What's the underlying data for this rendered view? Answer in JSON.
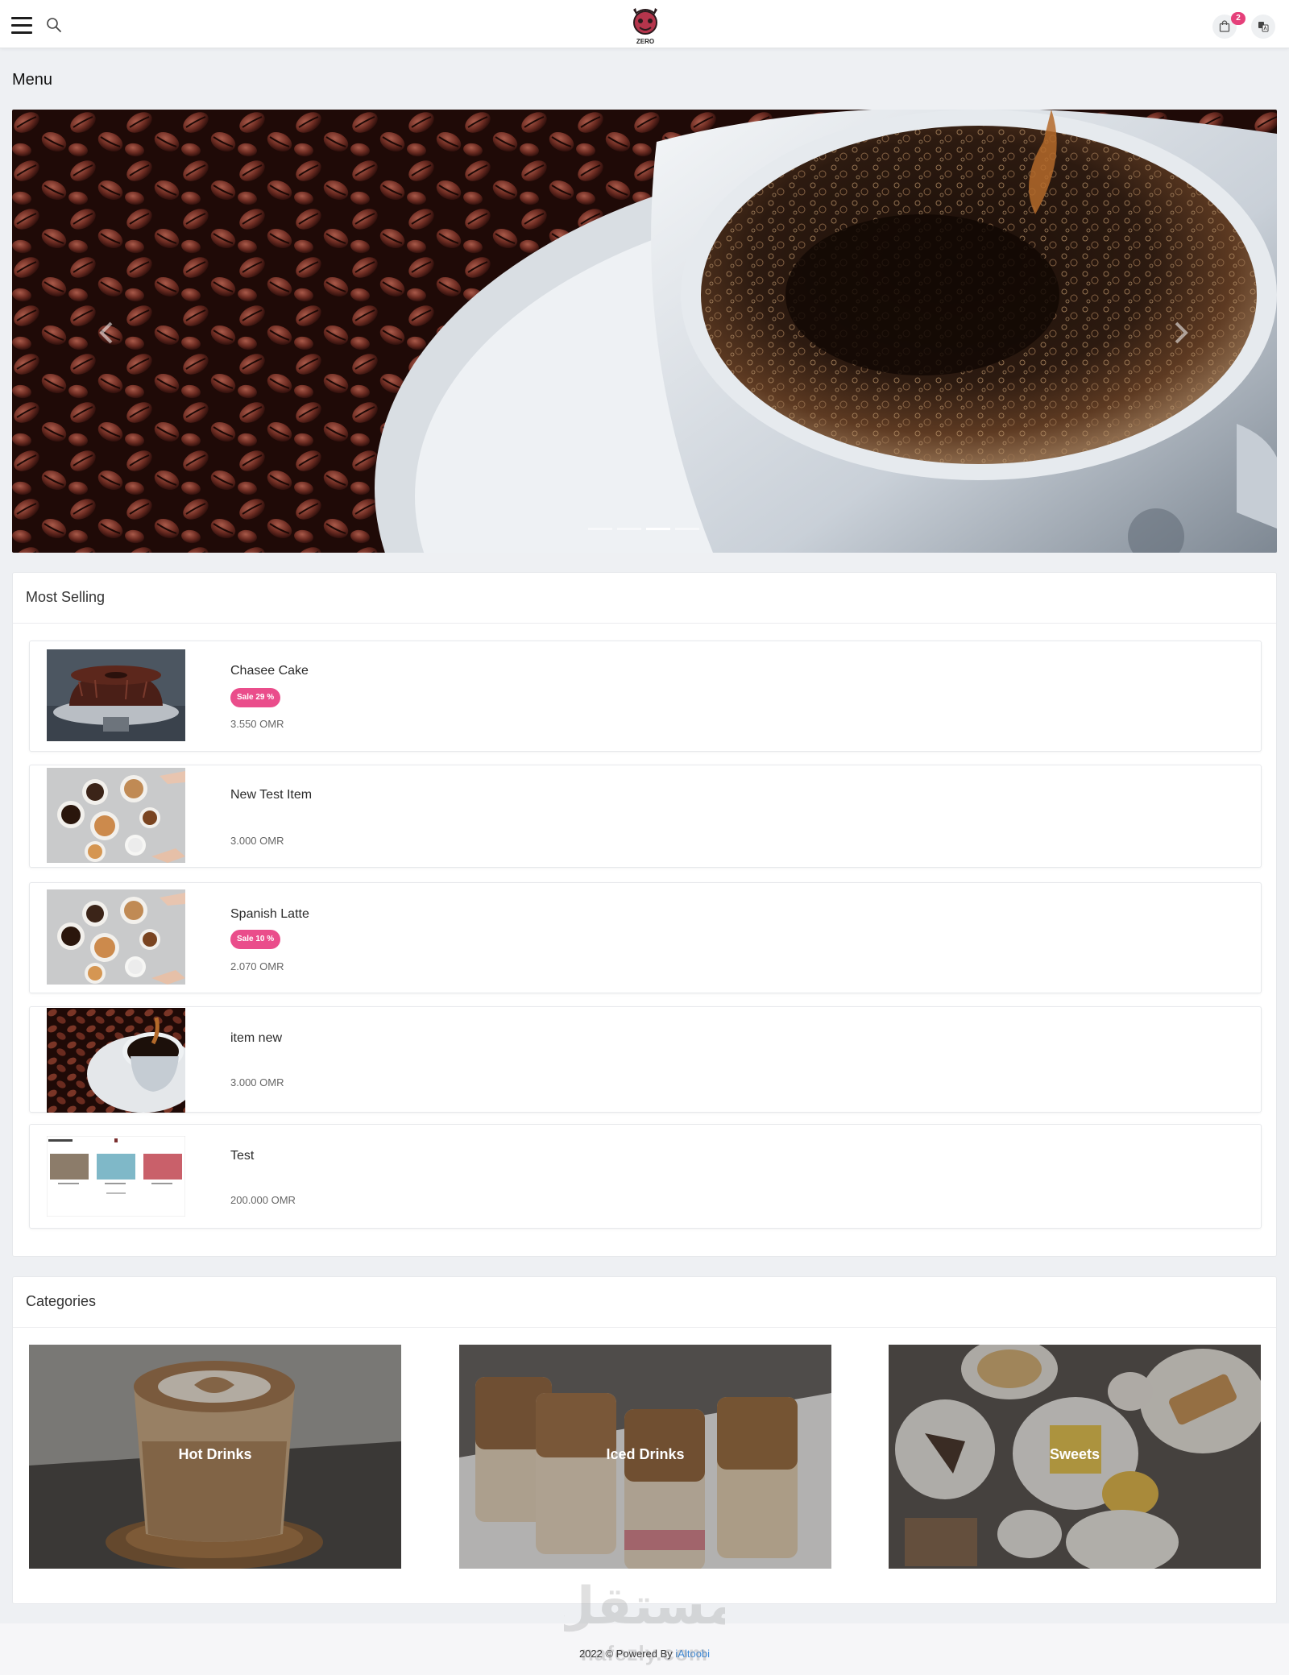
{
  "header": {
    "logo_text": "ZERO",
    "cart_count": "2"
  },
  "page": {
    "title": "Menu"
  },
  "hero": {
    "slide_count": 4,
    "active_slide": 2
  },
  "most_selling": {
    "title": "Most Selling",
    "items": [
      {
        "name": "Chasee Cake",
        "sale": "Sale 29 %",
        "price": "3.550 OMR",
        "thumb": "chocolate-bundt-cake"
      },
      {
        "name": "New Test Item",
        "sale": "",
        "price": "3.000 OMR",
        "thumb": "coffee-cups-top-view"
      },
      {
        "name": "Spanish Latte",
        "sale": "Sale 10 %",
        "price": "2.070 OMR",
        "thumb": "coffee-cups-top-view"
      },
      {
        "name": "item new",
        "sale": "",
        "price": "3.000 OMR",
        "thumb": "coffee-cup-beans"
      },
      {
        "name": "Test",
        "sale": "",
        "price": "200.000 OMR",
        "thumb": "website-screenshot"
      }
    ]
  },
  "categories": {
    "title": "Categories",
    "items": [
      {
        "label": "Hot Drinks",
        "image": "latte-art-glass"
      },
      {
        "label": "Iced Drinks",
        "image": "iced-coffee-glasses"
      },
      {
        "label": "Sweets",
        "image": "dessert-plates"
      }
    ]
  },
  "footer": {
    "text": "2022 © Powered By",
    "link": "iAltoobi"
  },
  "watermark": {
    "arabic": "مستقل",
    "latin": "nafezly.com"
  },
  "colors": {
    "accent": "#e5407a",
    "sale_badge": "#ea4d8b",
    "link": "#3f8ad6"
  }
}
